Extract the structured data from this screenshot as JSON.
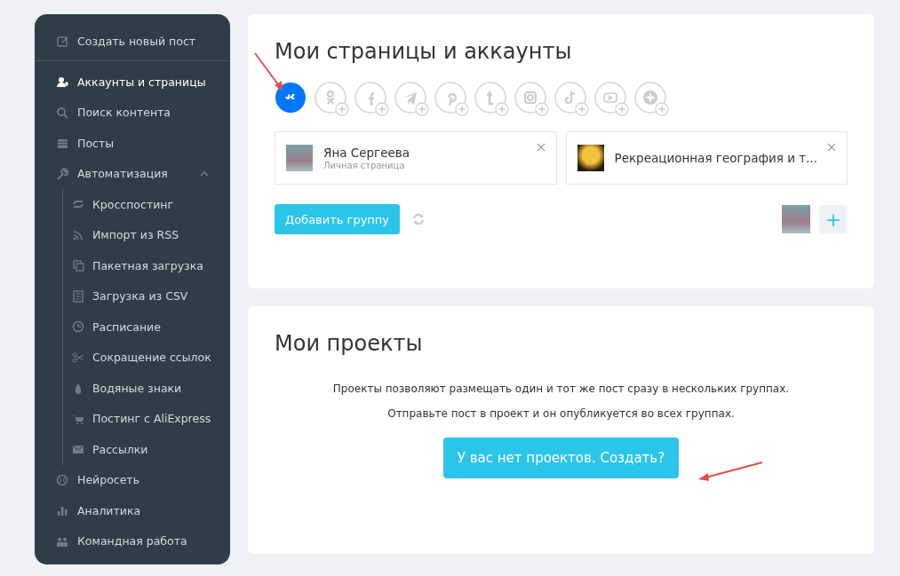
{
  "sidebar": {
    "items": [
      {
        "label": "Создать новый пост",
        "selected": false
      },
      {
        "label": "Аккаунты и страницы",
        "selected": true
      },
      {
        "label": "Поиск контента",
        "selected": false
      },
      {
        "label": "Посты",
        "selected": false
      },
      {
        "label": "Автоматизация",
        "selected": false,
        "expanded": true,
        "children": [
          {
            "label": "Кросспостинг",
            "selected": false
          },
          {
            "label": "Импорт из RSS",
            "selected": false
          },
          {
            "label": "Пакетная загрузка",
            "selected": false
          },
          {
            "label": "Загрузка из CSV",
            "selected": false
          },
          {
            "label": "Расписание",
            "selected": false
          },
          {
            "label": "Сокращение ссылок",
            "selected": false
          },
          {
            "label": "Водяные знаки",
            "selected": false
          },
          {
            "label": "Постинг с AliExpress",
            "selected": false
          },
          {
            "label": "Рассылки",
            "selected": false
          }
        ]
      },
      {
        "label": "Нейросеть",
        "selected": false
      },
      {
        "label": "Аналитика",
        "selected": false
      },
      {
        "label": "Командная работа",
        "selected": false
      }
    ]
  },
  "accounts_card": {
    "title": "Мои страницы и аккаунты",
    "networks": [
      {
        "selected": true
      },
      {
        "selected": false
      },
      {
        "selected": false
      },
      {
        "selected": false
      },
      {
        "selected": false
      },
      {
        "selected": false
      },
      {
        "selected": false
      },
      {
        "selected": false
      },
      {
        "selected": false
      },
      {
        "selected": false
      }
    ],
    "pages": [
      {
        "name": "Яна Сергеева",
        "subtitle": "Личная страница"
      },
      {
        "name": "Рекреационная география и т..."
      }
    ],
    "add_group_button": "Добавить группу",
    "add_button": "+"
  },
  "projects_card": {
    "title": "Мои проекты",
    "lines": [
      "Проекты позволяют размещать один и тот же пост сразу в нескольких группах.",
      "Отправьте пост в проект и он опубликуется во всех группах."
    ],
    "create_button": "У вас нет проектов. Создать?"
  }
}
